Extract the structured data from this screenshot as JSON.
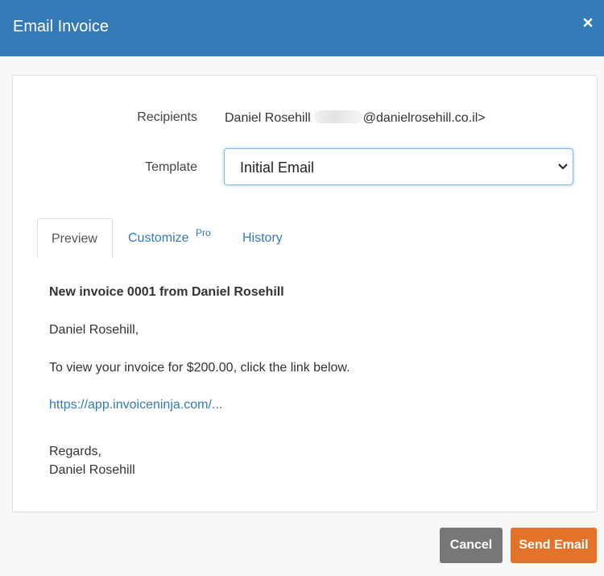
{
  "modal": {
    "title": "Email Invoice"
  },
  "form": {
    "recipients_label": "Recipients",
    "recipients_name": "Daniel Rosehill",
    "recipients_email_domain": "@danielrosehill.co.il>",
    "template_label": "Template",
    "template_selected": "Initial Email"
  },
  "tabs": [
    {
      "label": "Preview",
      "active": true
    },
    {
      "label": "Customize",
      "badge": "Pro"
    },
    {
      "label": "History"
    }
  ],
  "email": {
    "subject": "New invoice 0001 from Daniel Rosehill",
    "greeting": "Daniel Rosehill,",
    "message": "To view your invoice for $200.00, click the link below.",
    "link": "https://app.invoiceninja.com/...",
    "signoff": "Regards,",
    "signature": "Daniel Rosehill"
  },
  "footer": {
    "cancel_label": "Cancel",
    "send_label": "Send Email"
  },
  "colors": {
    "header": "#337ab7",
    "send": "#e27329",
    "cancel": "#777777",
    "link": "#337ab7"
  },
  "icons": {
    "close": "close-icon",
    "select": "chevron-down-icon"
  }
}
